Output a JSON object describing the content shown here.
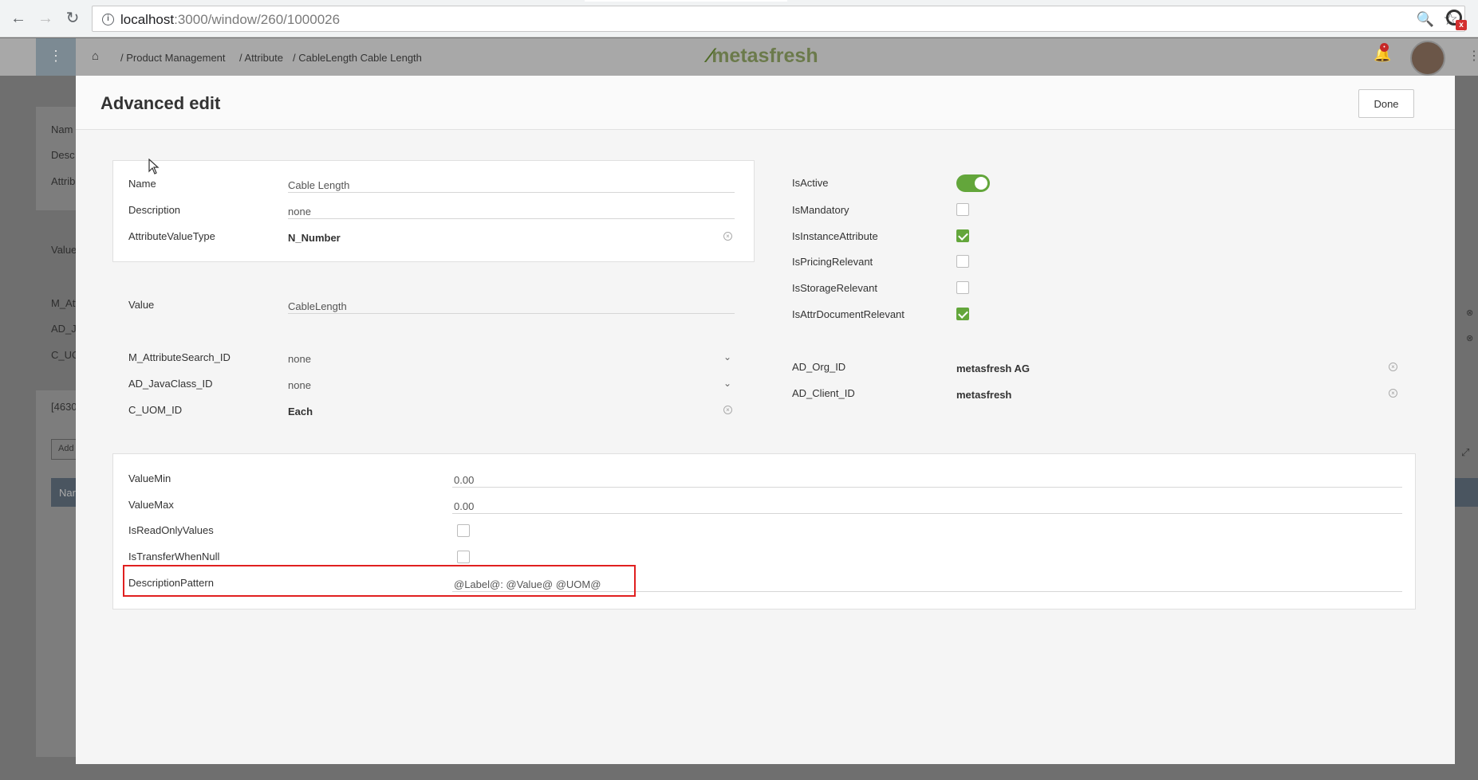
{
  "browser": {
    "url_host": "localhost",
    "url_path": ":3000/window/260/1000026"
  },
  "app_header": {
    "breadcrumb": [
      {
        "label": "/ Product Management"
      },
      {
        "label": "/ Attribute"
      },
      {
        "label": "/ CableLength Cable Length"
      }
    ],
    "logo": "metasfresh"
  },
  "background": {
    "labels": [
      "Nam",
      "Desc",
      "Attrib",
      "Value",
      "M_Attr",
      "AD_Ja",
      "C_UO",
      "[4630",
      "Add",
      "Nar"
    ]
  },
  "modal": {
    "title": "Advanced edit",
    "done_label": "Done",
    "left_panel": {
      "name": {
        "label": "Name",
        "value": "Cable Length"
      },
      "description": {
        "label": "Description",
        "value": "none"
      },
      "value_type": {
        "label": "AttributeValueType",
        "value": "N_Number"
      }
    },
    "value": {
      "label": "Value",
      "value": "CableLength"
    },
    "lookups": {
      "search": {
        "label": "M_AttributeSearch_ID",
        "value": "none"
      },
      "javaclass": {
        "label": "AD_JavaClass_ID",
        "value": "none"
      },
      "uom": {
        "label": "C_UOM_ID",
        "value": "Each"
      }
    },
    "flags": {
      "active": {
        "label": "IsActive",
        "checked": true
      },
      "mandatory": {
        "label": "IsMandatory",
        "checked": false
      },
      "instance": {
        "label": "IsInstanceAttribute",
        "checked": true
      },
      "pricing": {
        "label": "IsPricingRelevant",
        "checked": false
      },
      "storage": {
        "label": "IsStorageRelevant",
        "checked": false
      },
      "document": {
        "label": "IsAttrDocumentRelevant",
        "checked": true
      }
    },
    "org": {
      "org": {
        "label": "AD_Org_ID",
        "value": "metasfresh AG"
      },
      "client": {
        "label": "AD_Client_ID",
        "value": "metasfresh"
      }
    },
    "bottom_panel": {
      "value_min": {
        "label": "ValueMin",
        "value": "0.00"
      },
      "value_max": {
        "label": "ValueMax",
        "value": "0.00"
      },
      "readonly": {
        "label": "IsReadOnlyValues",
        "checked": false
      },
      "transfer": {
        "label": "IsTransferWhenNull",
        "checked": false
      },
      "pattern": {
        "label": "DescriptionPattern",
        "value": "@Label@: @Value@ @UOM@"
      }
    }
  },
  "colors": {
    "accent_green": "#63a63b",
    "highlight_red": "#e02020"
  }
}
